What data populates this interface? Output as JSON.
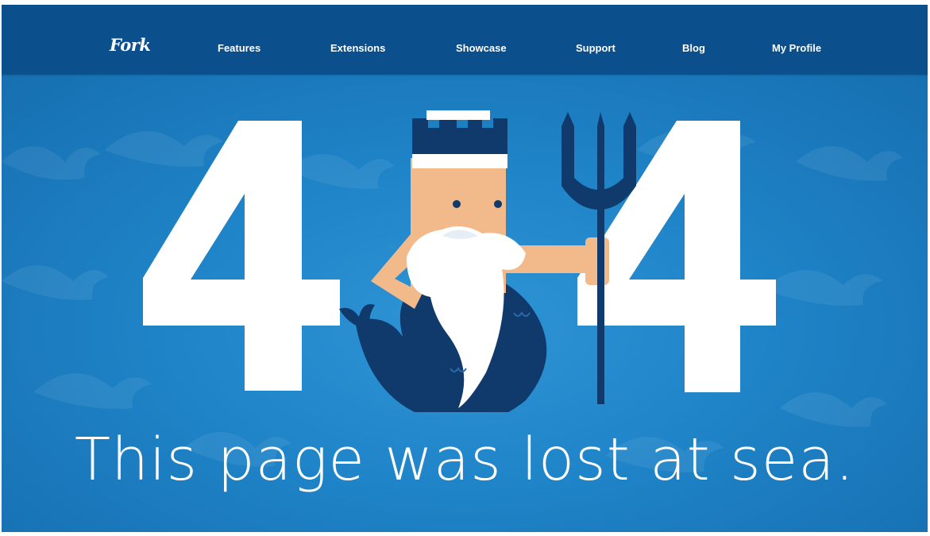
{
  "nav": {
    "logo": "Fork",
    "items": [
      {
        "label": "Features"
      },
      {
        "label": "Extensions"
      },
      {
        "label": "Showcase"
      },
      {
        "label": "Support"
      },
      {
        "label": "Blog"
      },
      {
        "label": "My Profile"
      }
    ]
  },
  "hero": {
    "digit_left": "4",
    "digit_right": "4",
    "illustration": "neptune-mermaid-with-trident",
    "tagline": "This page was lost at sea."
  },
  "colors": {
    "navbar": "#0b4f8c",
    "ocean": "#1f84c8",
    "ocean_light": "#2f95d6",
    "navy": "#0f3a6b",
    "skin": "#f2b98a",
    "white": "#ffffff"
  }
}
